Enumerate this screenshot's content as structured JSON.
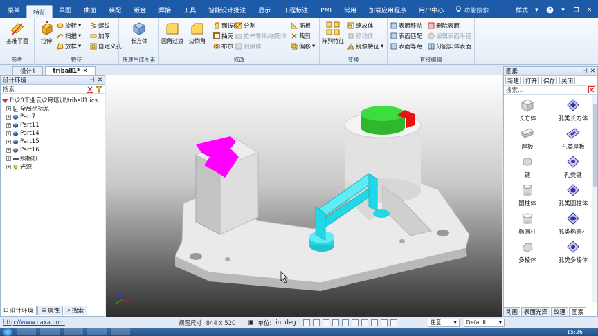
{
  "menubar": {
    "items": [
      "菜单",
      "特征",
      "草图",
      "曲面",
      "装配",
      "钣金",
      "焊接",
      "工具",
      "智能设计批注",
      "显示",
      "工程标注",
      "PMI",
      "常用",
      "加载应用程序",
      "用户中心"
    ],
    "active_index": 1,
    "search_placeholder": "功能搜索",
    "style_label": "样式"
  },
  "ribbon": {
    "groups": [
      {
        "label": "参考",
        "big": [
          "基准平面"
        ]
      },
      {
        "label": "特征",
        "big": [
          "拉伸"
        ],
        "small": [
          "旋转",
          "扫描",
          "放样",
          "螺纹",
          "加厚",
          "自定义孔"
        ]
      },
      {
        "label": "快速生成图素",
        "big": [
          "长方体"
        ]
      },
      {
        "label": "修改",
        "big": [
          "圆角过渡",
          "边倒角"
        ],
        "small": [
          "面拔模",
          "抽壳",
          "布尔",
          "分割",
          "拉伸零件/装配体",
          "删除体",
          "筋板",
          "裁剪",
          "偏移"
        ]
      },
      {
        "label": "变换",
        "big": [
          "阵列特征"
        ],
        "small": [
          "缩放体",
          "移动体",
          "镜像特征"
        ]
      },
      {
        "label": "直接编辑",
        "small": [
          "表面移动",
          "表面匹配",
          "表面等距",
          "删除表面",
          "编辑表面半径",
          "分割实体表面"
        ]
      }
    ]
  },
  "doc_tabs": [
    "设计1",
    "triball1*"
  ],
  "left_panel": {
    "title": "设计环境",
    "search_label": "搜索...",
    "tree": [
      {
        "label": "F:\\20工业云\\2月培训\\triball1.ics",
        "level": 0
      },
      {
        "label": "全局坐标系",
        "level": 1
      },
      {
        "label": "Part7",
        "level": 1
      },
      {
        "label": "Part11",
        "level": 1
      },
      {
        "label": "Part14",
        "level": 1
      },
      {
        "label": "Part15",
        "level": 1
      },
      {
        "label": "Part16",
        "level": 1
      },
      {
        "label": "照相机",
        "level": 1
      },
      {
        "label": "光源",
        "level": 1
      }
    ],
    "bottom_tabs": [
      "设计环境",
      "属性",
      "搜索"
    ]
  },
  "right_panel": {
    "title": "图素",
    "toolbar": [
      "新建",
      "打开",
      "保存",
      "关闭"
    ],
    "search_label": "搜索...",
    "items": [
      "长方体",
      "孔类长方体",
      "厚板",
      "孔类厚板",
      "键",
      "孔类键",
      "圆柱体",
      "孔类圆柱体",
      "椭圆柱",
      "孔类椭圆柱",
      "多棱体",
      "孔类多棱体"
    ],
    "bottom_tabs": [
      "动画",
      "表面光泽",
      "纹理",
      "图素"
    ]
  },
  "statusbar": {
    "link": "http://www.caxa.com",
    "view_size_label": "视图尺寸:",
    "view_size": "844 x 520",
    "unit_label": "单位:",
    "unit_value": "in, deg",
    "combo1": "任意",
    "combo2": "Default"
  },
  "taskbar": {
    "clock": "15:26"
  },
  "colors": {
    "menubar": "#1d5aa8",
    "magenta": "#ff00ff",
    "cyan": "#22d8e6",
    "green": "#39d13a",
    "red": "#ee1111"
  }
}
